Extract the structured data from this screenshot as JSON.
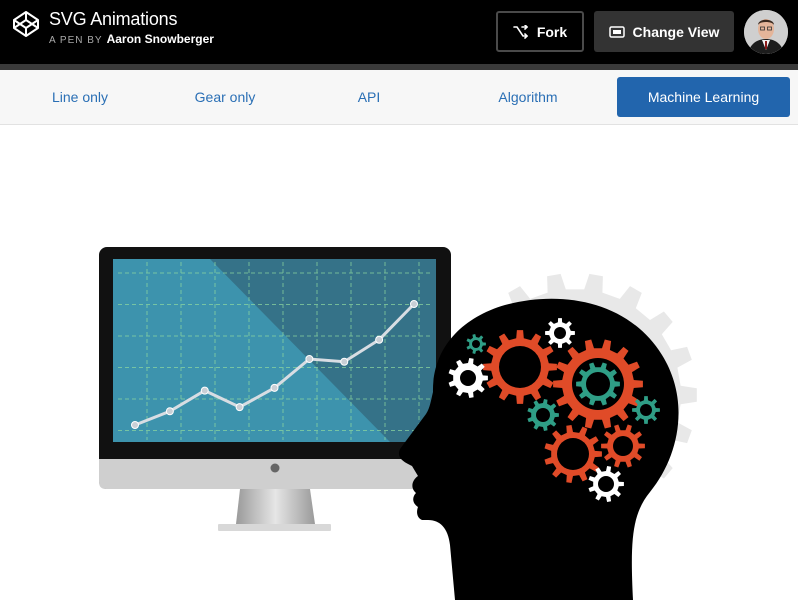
{
  "header": {
    "title": "SVG Animations",
    "byline_prefix": "A PEN BY",
    "author": "Aaron Snowberger",
    "fork_label": "Fork",
    "change_view_label": "Change View",
    "icons": [
      "codepen-logo-icon",
      "fork-icon",
      "change-view-icon",
      "user-avatar"
    ]
  },
  "tabs": [
    {
      "label": "Line only",
      "active": false
    },
    {
      "label": "Gear only",
      "active": false
    },
    {
      "label": "API",
      "active": false
    },
    {
      "label": "Algorithm",
      "active": false
    },
    {
      "label": "Machine Learning",
      "active": true
    }
  ],
  "colors": {
    "header_bg": "#000000",
    "tab_active": "#2265ad",
    "tab_text": "#2a6fb5",
    "screen": "#3d93ad",
    "gear_orange": "#e04b28",
    "gear_teal": "#2f9e86",
    "gear_white": "#ffffff",
    "gear_gray": "#e8e8e8"
  },
  "chart_data": {
    "type": "line",
    "values": [
      0,
      1,
      2.5,
      1.3,
      2.7,
      4.8,
      4.6,
      6.2,
      8.8
    ]
  }
}
